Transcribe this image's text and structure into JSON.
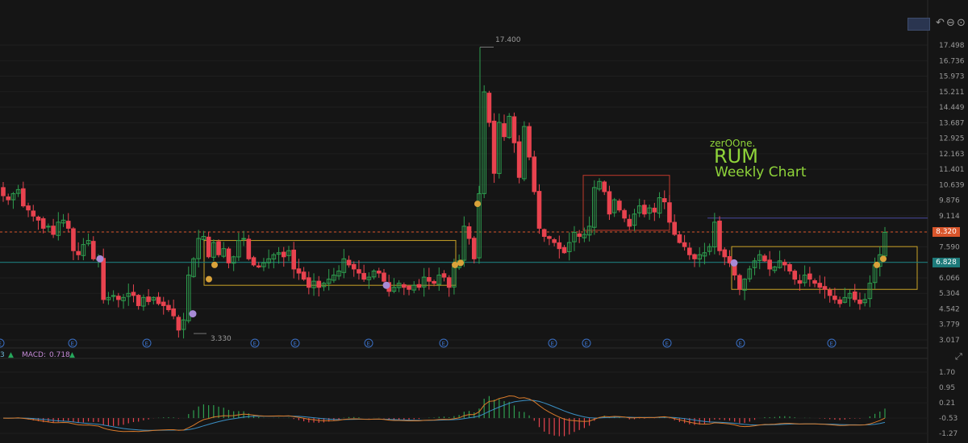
{
  "watermark": {
    "author": "zerOOne.",
    "ticker": "RUM",
    "subtitle": "Weekly Chart"
  },
  "price_axis": {
    "ticks": [
      "17.498",
      "16.736",
      "15.973",
      "15.211",
      "14.449",
      "13.687",
      "12.925",
      "12.163",
      "11.401",
      "10.639",
      "9.876",
      "9.114",
      "8.320",
      "7.590",
      "6.828",
      "6.066",
      "5.304",
      "4.542",
      "3.779",
      "3.017"
    ]
  },
  "macd_axis": {
    "ticks": [
      "1.70",
      "0.95",
      "0.21",
      "-0.53",
      "-1.27"
    ]
  },
  "controls": {
    "undo": "↶",
    "redo": "⊖",
    "settings": "⊙"
  },
  "high_label": "17.400",
  "low_label": "3.330",
  "last_price": "8.320",
  "level_price": "6.828",
  "indicator": {
    "prefix": "3",
    "macd_label": "MACD:",
    "macd_value": "0.718",
    "arrow": "▲"
  },
  "expand_icon": "⤢",
  "chart_data": {
    "type": "candlestick",
    "ylim": [
      2.9,
      17.9
    ],
    "closes": [
      10.1,
      9.9,
      10.2,
      10.4,
      9.6,
      9.4,
      9.1,
      8.9,
      8.5,
      8.6,
      8.2,
      8.8,
      8.9,
      8.5,
      7.4,
      7.2,
      7.7,
      7.9,
      7.0,
      7.0,
      5.0,
      5.1,
      5.2,
      5.0,
      5.1,
      5.3,
      5.2,
      4.7,
      5.1,
      4.9,
      5.1,
      4.8,
      4.7,
      4.5,
      4.2,
      3.5,
      4.0,
      6.2,
      7.0,
      8.0,
      8.1,
      7.1,
      7.8,
      7.2,
      7.5,
      6.8,
      7.1,
      7.9,
      8.0,
      7.0,
      6.7,
      6.6,
      6.8,
      7.0,
      7.2,
      7.3,
      7.1,
      7.4,
      6.5,
      6.3,
      6.0,
      5.6,
      5.9,
      5.6,
      5.8,
      6.0,
      6.2,
      6.4,
      7.0,
      6.7,
      6.5,
      6.3,
      6.0,
      6.1,
      6.4,
      6.3,
      5.9,
      5.4,
      5.6,
      5.8,
      5.6,
      5.5,
      5.7,
      5.6,
      6.1,
      5.9,
      5.8,
      6.2,
      6.1,
      5.6,
      6.6,
      6.9,
      8.6,
      8.0,
      7.0,
      10.2,
      15.2,
      13.7,
      11.2,
      13.7,
      13.0,
      14.0,
      12.7,
      11.0,
      13.5,
      12.0,
      10.3,
      8.5,
      8.1,
      8.0,
      7.8,
      7.5,
      7.3,
      7.8,
      8.3,
      8.1,
      8.2,
      8.6,
      10.5,
      10.8,
      10.3,
      9.2,
      9.9,
      9.4,
      9.0,
      8.6,
      9.2,
      9.6,
      9.2,
      9.5,
      9.3,
      10.0,
      9.8,
      8.8,
      8.2,
      7.8,
      7.6,
      7.2,
      7.0,
      7.2,
      7.3,
      7.6,
      8.8,
      7.4,
      7.1,
      6.8,
      6.2,
      5.5,
      6.0,
      6.5,
      6.9,
      7.2,
      6.9,
      6.5,
      6.6,
      6.9,
      6.7,
      6.4,
      6.0,
      5.8,
      6.2,
      6.0,
      5.8,
      5.6,
      5.5,
      5.2,
      5.0,
      4.8,
      5.1,
      5.3,
      5.0,
      4.8,
      5.0,
      5.8,
      6.7,
      7.2,
      8.3
    ],
    "channels": [
      {
        "x0": 253,
        "x1": 565,
        "y0": 5.7,
        "y1": 7.9,
        "color": "#c9a227"
      },
      {
        "x0": 907,
        "x1": 1137,
        "y0": 5.5,
        "y1": 7.6,
        "color": "#c9a227"
      },
      {
        "x0": 723,
        "x1": 830,
        "y0": 8.4,
        "y1": 11.1,
        "color": "#c0392b"
      }
    ],
    "up_color": "#2e9e4f",
    "down_color": "#e8434f",
    "macd_line_color": "#3a8fc4",
    "signal_line_color": "#d97a2b"
  }
}
